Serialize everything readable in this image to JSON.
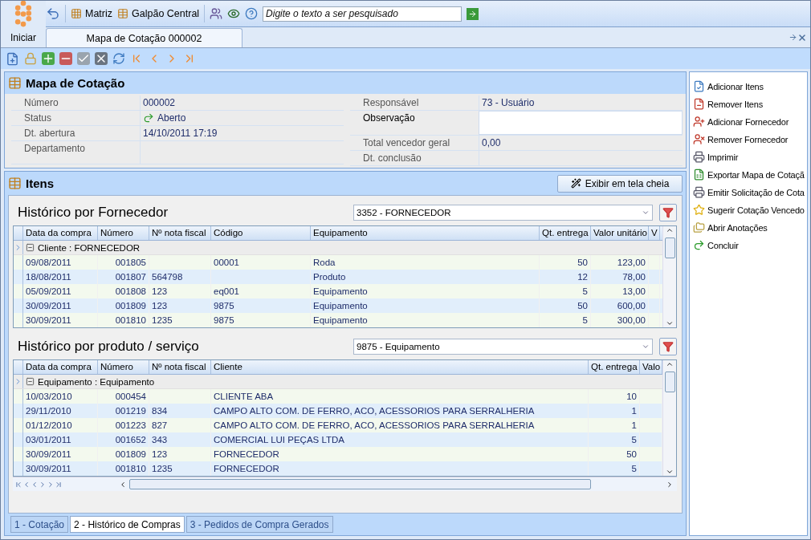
{
  "start_button": {
    "label": "Iniciar"
  },
  "top_toolbar": {
    "branch": "Matriz",
    "warehouse": "Galpão Central",
    "search": {
      "placeholder": "Digite o texto a ser pesquisado"
    }
  },
  "document_tabs": [
    {
      "label": "Mapa de Cotação 000002",
      "selected": true
    }
  ],
  "form": {
    "title": "Mapa de Cotação",
    "left": [
      {
        "label": "Número",
        "value": "000002",
        "kind": "text"
      },
      {
        "label": "Status",
        "value": "Aberto",
        "kind": "status"
      },
      {
        "label": "Dt. abertura",
        "value": "14/10/2011 17:19",
        "kind": "text"
      },
      {
        "label": "Departamento",
        "kind": "tall"
      }
    ],
    "right": [
      {
        "label": "Responsável",
        "value": "73 - Usuário",
        "kind": "text"
      },
      {
        "label": "Observação",
        "kind": "memo"
      },
      {
        "label": "Total vencedor geral",
        "value": "0,00",
        "kind": "text"
      },
      {
        "label": "Dt. conclusão",
        "kind": "text"
      }
    ]
  },
  "items_section": {
    "title": "Itens",
    "fullscreen_button": "Exibir em tela cheia"
  },
  "grids": [
    {
      "title": "Histórico por Fornecedor",
      "filter": "3352 - FORNECEDOR",
      "group": "Cliente : FORNECEDOR",
      "columns": [
        "Data da compra",
        "Número",
        "Nº nota fiscal",
        "Código",
        "Equipamento",
        "Qt. entrega",
        "Valor unitário",
        "V"
      ],
      "rows": [
        [
          "09/08/2011",
          "001805",
          "",
          "00001",
          "Roda",
          "50",
          "123,00",
          ""
        ],
        [
          "18/08/2011",
          "001807",
          "564798",
          "",
          "Produto",
          "12",
          "78,00",
          ""
        ],
        [
          "05/09/2011",
          "001808",
          "123",
          "eq001",
          "Equipamento",
          "5",
          "13,00",
          ""
        ],
        [
          "30/09/2011",
          "001809",
          "123",
          "9875",
          "Equipamento",
          "50",
          "600,00",
          ""
        ],
        [
          "30/09/2011",
          "001810",
          "1235",
          "9875",
          "Equipamento",
          "5",
          "300,00",
          ""
        ]
      ]
    },
    {
      "title": "Histórico por produto / serviço",
      "filter": "9875 - Equipamento",
      "group": "Equipamento : Equipamento",
      "columns": [
        "Data da compra",
        "Número",
        "Nº nota fiscal",
        "Cliente",
        "Qt. entrega",
        "Valo"
      ],
      "rows": [
        [
          "10/03/2010",
          "000454",
          "",
          "CLIENTE ABA",
          "10",
          ""
        ],
        [
          "29/11/2010",
          "001219",
          "834",
          "CAMPO ALTO COM. DE FERRO, ACO, ACESSORIOS PARA SERRALHERIA",
          "1",
          ""
        ],
        [
          "01/12/2010",
          "001223",
          "827",
          "CAMPO ALTO COM. DE FERRO, ACO, ACESSORIOS PARA SERRALHERIA",
          "1",
          ""
        ],
        [
          "03/01/2011",
          "001652",
          "343",
          "COMERCIAL LUI PEÇAS LTDA",
          "5",
          ""
        ],
        [
          "30/09/2011",
          "001809",
          "123",
          "FORNECEDOR",
          "50",
          ""
        ],
        [
          "30/09/2011",
          "001810",
          "1235",
          "FORNECEDOR",
          "5",
          ""
        ]
      ]
    }
  ],
  "bottom_tabs": [
    {
      "label": "1 - Cotação",
      "selected": false
    },
    {
      "label": "2 - Histórico de Compras",
      "selected": true
    },
    {
      "label": "3 - Pedidos de Compra Gerados",
      "selected": false
    }
  ],
  "actions": [
    "Adicionar Itens",
    "Remover Itens",
    "Adicionar Fornecedor",
    "Remover Fornecedor",
    "Imprimir",
    "Exportar Mapa de Cotaçã",
    "Emitir Solicitação de Cota",
    "Sugerir Cotação Vencedo",
    "Abrir Anotações",
    "Concluir"
  ]
}
